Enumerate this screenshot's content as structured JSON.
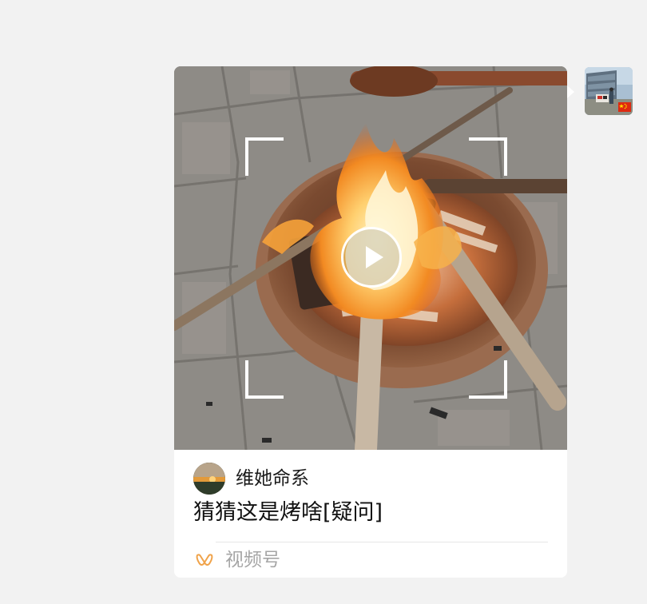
{
  "message": {
    "author": {
      "name": "维她命系"
    },
    "caption": "猜猜这是烤啥[疑问]",
    "source_label": "视频号",
    "thumbnail": {
      "subject": "campfire-in-iron-bowl",
      "play_icon": "play-icon"
    }
  },
  "sender": {
    "avatar_icon": "user-avatar",
    "badge_icon": "china-flag-icon"
  },
  "colors": {
    "background": "#f2f2f2",
    "card": "#ffffff",
    "caption_text": "#111111",
    "source_text": "#a6a6a6",
    "channels_icon": "#f0a34a"
  }
}
